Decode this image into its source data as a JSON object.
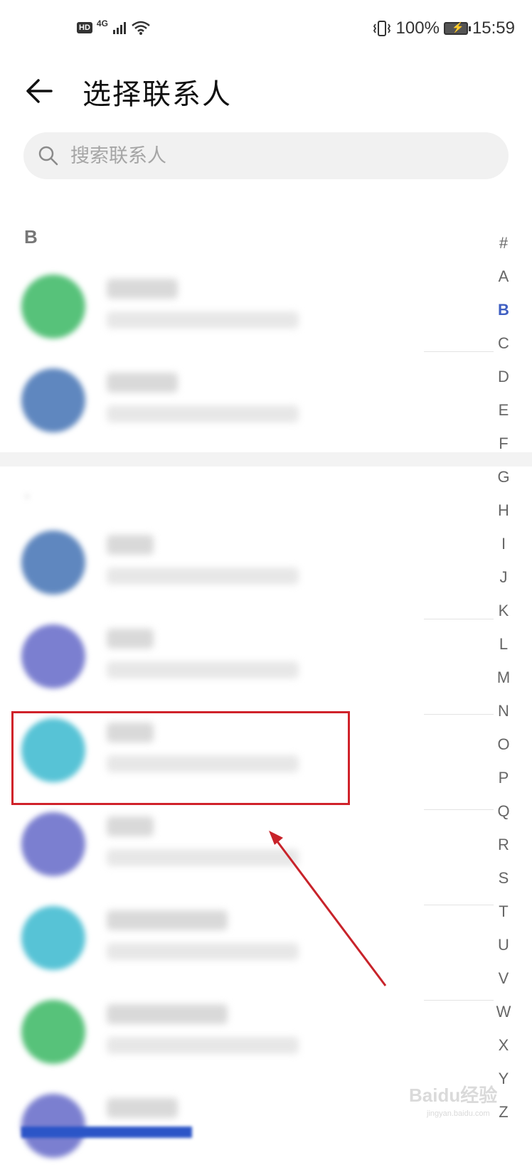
{
  "status_bar": {
    "hd": "HD",
    "network": "4G",
    "battery_text": "100%",
    "time": "15:59"
  },
  "header": {
    "title": "选择联系人"
  },
  "search": {
    "placeholder": "搜索联系人"
  },
  "section": {
    "letter": "B"
  },
  "alphabet_index": [
    "#",
    "A",
    "B",
    "C",
    "D",
    "E",
    "F",
    "G",
    "H",
    "I",
    "J",
    "K",
    "L",
    "M",
    "N",
    "O",
    "P",
    "Q",
    "R",
    "S",
    "T",
    "U",
    "V",
    "W",
    "X",
    "Y",
    "Z"
  ],
  "alphabet_active": "B",
  "contacts": [
    {
      "avatar_color": "#57c27a"
    },
    {
      "avatar_color": "#5f87bf"
    },
    {
      "avatar_color": "#5f87bf"
    },
    {
      "avatar_color": "#7b7fd0"
    },
    {
      "avatar_color": "#57c3d6"
    },
    {
      "avatar_color": "#7b7fd0"
    },
    {
      "avatar_color": "#57c3d6"
    },
    {
      "avatar_color": "#57c27a"
    },
    {
      "avatar_color": "#7b7fd0"
    }
  ],
  "highlight_color": "#d0222a",
  "watermark": {
    "text": "Baidu经验",
    "sub": "jingyan.baidu.com"
  }
}
